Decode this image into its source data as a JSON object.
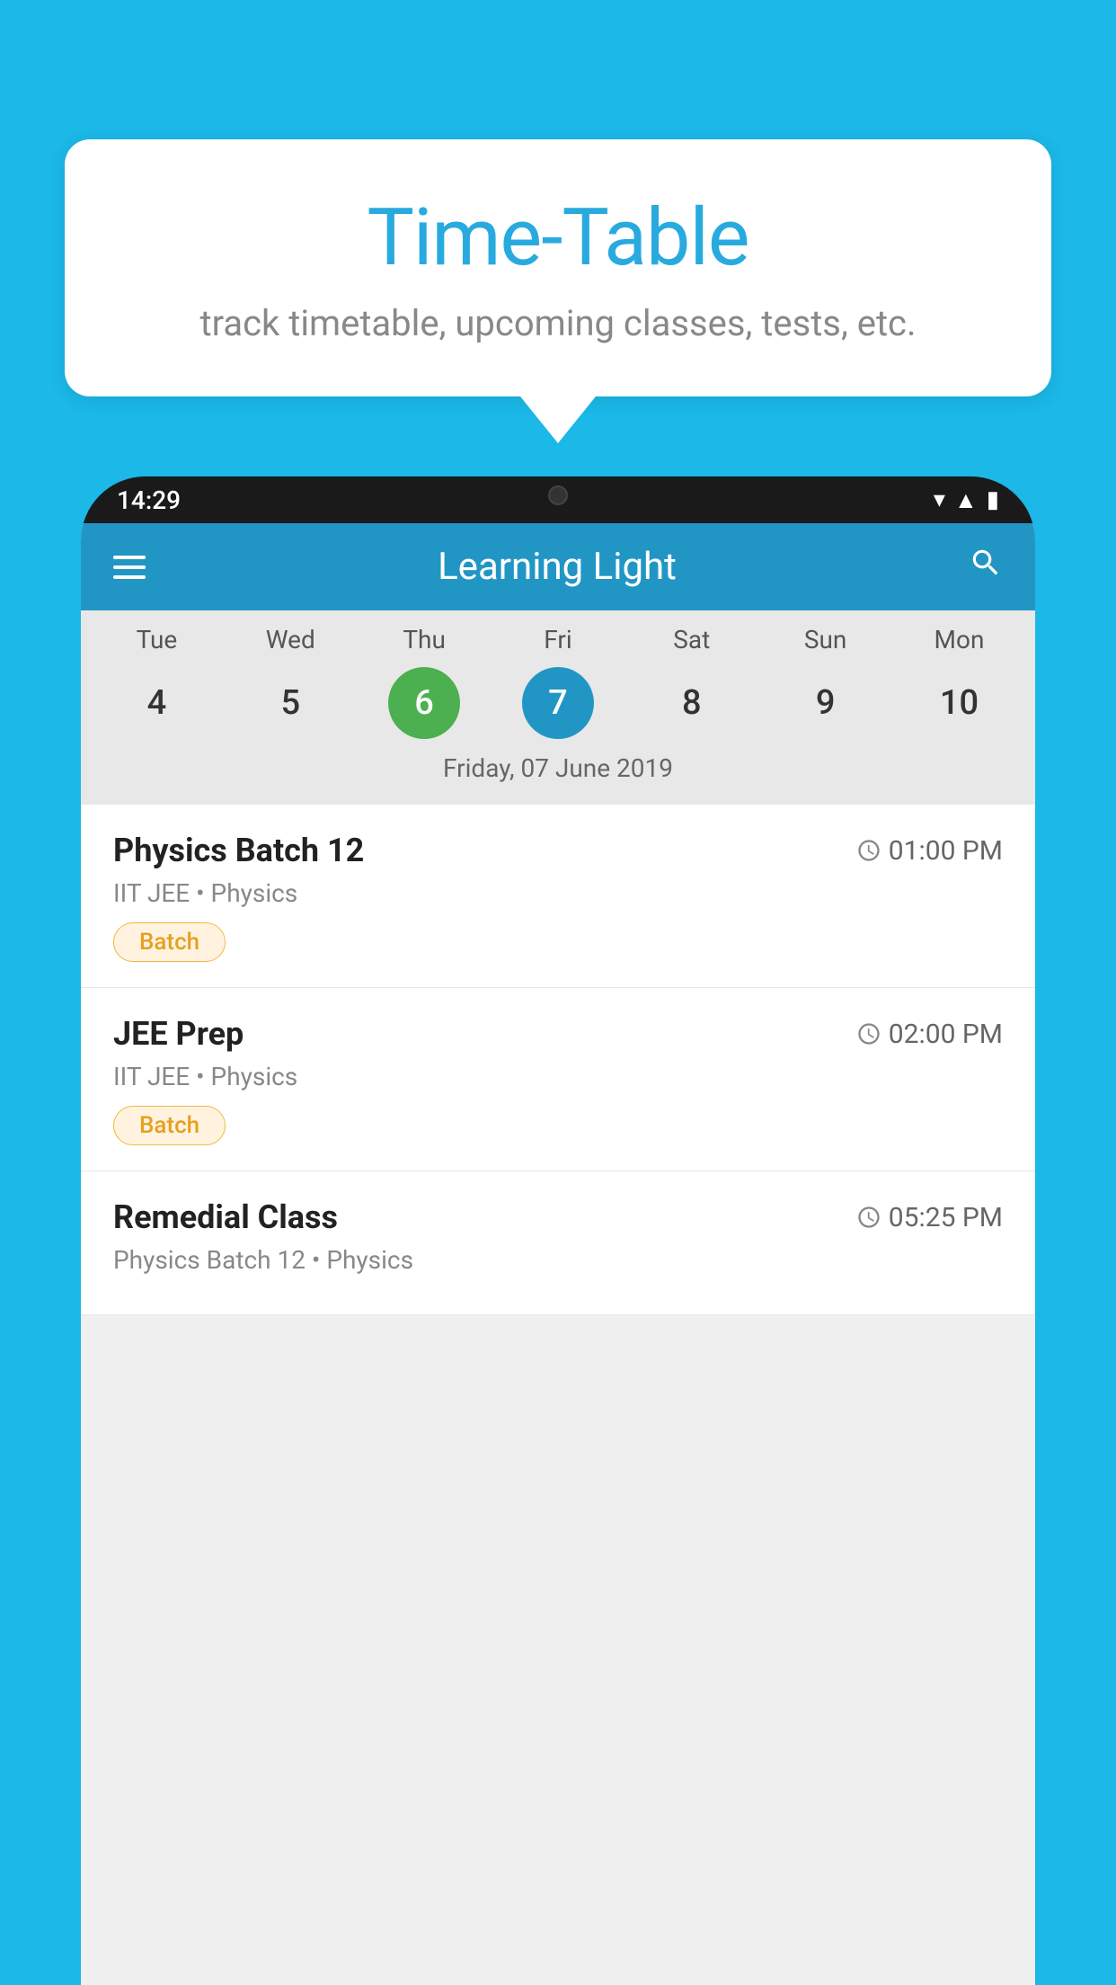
{
  "background_color": "#1BB8E8",
  "speech_bubble": {
    "title": "Time-Table",
    "subtitle": "track timetable, upcoming classes, tests, etc."
  },
  "phone": {
    "status_bar": {
      "time": "14:29"
    },
    "app_header": {
      "title": "Learning Light"
    },
    "calendar": {
      "days": [
        "Tue",
        "Wed",
        "Thu",
        "Fri",
        "Sat",
        "Sun",
        "Mon"
      ],
      "dates": [
        "4",
        "5",
        "6",
        "7",
        "8",
        "9",
        "10"
      ],
      "today_index": 2,
      "selected_index": 3,
      "selected_label": "Friday, 07 June 2019"
    },
    "classes": [
      {
        "name": "Physics Batch 12",
        "time": "01:00 PM",
        "subtitle": "IIT JEE • Physics",
        "tag": "Batch"
      },
      {
        "name": "JEE Prep",
        "time": "02:00 PM",
        "subtitle": "IIT JEE • Physics",
        "tag": "Batch"
      },
      {
        "name": "Remedial Class",
        "time": "05:25 PM",
        "subtitle": "Physics Batch 12 • Physics",
        "tag": ""
      }
    ]
  }
}
